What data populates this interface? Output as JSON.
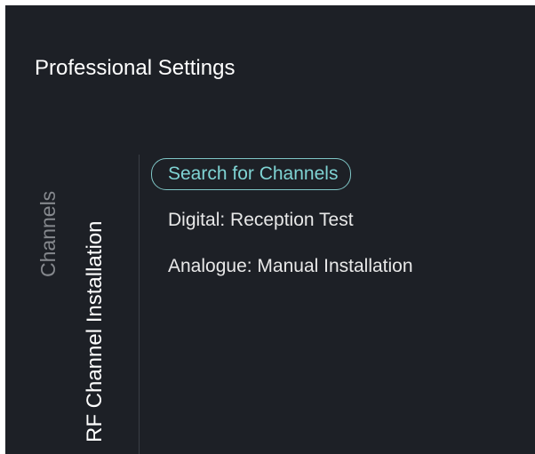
{
  "header": {
    "title": "Professional Settings"
  },
  "breadcrumb": {
    "parent": "Channels",
    "current": "RF Channel Installation"
  },
  "menu": {
    "items": [
      {
        "label": "Search for Channels",
        "selected": true
      },
      {
        "label": "Digital: Reception Test",
        "selected": false
      },
      {
        "label": "Analogue: Manual Installation",
        "selected": false
      }
    ]
  },
  "colors": {
    "background": "#1d2026",
    "accent": "#7fd3d3",
    "text": "#e8e8e8",
    "muted": "#85888d"
  }
}
